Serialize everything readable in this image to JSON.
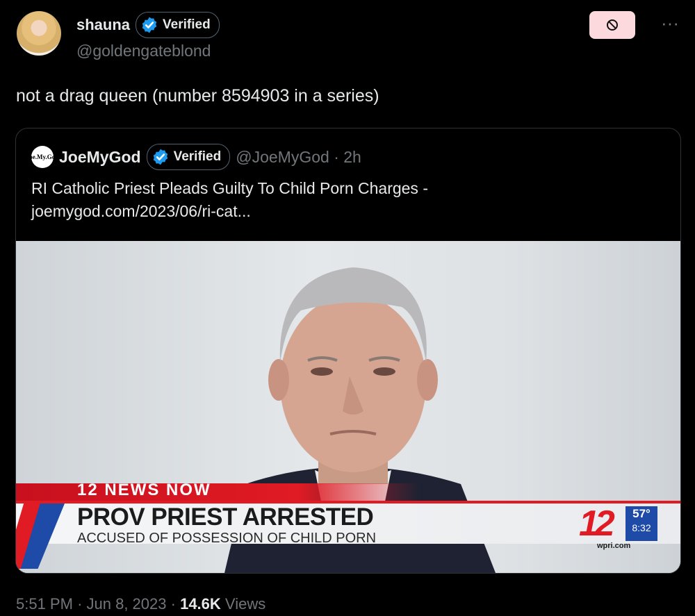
{
  "author": {
    "display_name": "shauna",
    "verified_label": "Verified",
    "handle": "@goldengateblond"
  },
  "tweet": {
    "text": "not a drag queen (number 8594903 in a series)"
  },
  "quoted": {
    "avatar_text": "Joe.My.God",
    "display_name": "JoeMyGod",
    "verified_label": "Verified",
    "handle_time": "@JoeMyGod · 2h",
    "text_line1": "RI Catholic Priest Pleads Guilty To Child Porn Charges -",
    "text_line2": "joemygod.com/2023/06/ri-cat...",
    "media": {
      "banner_tag": "12 NEWS NOW",
      "headline": "PROV PRIEST ARRESTED",
      "subhead": "ACCUSED OF POSSESSION OF CHILD PORN",
      "logo": "12",
      "temperature": "57°",
      "clock": "8:32",
      "site": "wpri.com"
    }
  },
  "footer": {
    "time": "5:51 PM",
    "date": "Jun 8, 2023",
    "views_count": "14.6K",
    "views_label": "Views",
    "sep": "·"
  },
  "colors": {
    "background": "#000000",
    "text": "#e7e9ea",
    "muted": "#71767b",
    "verified": "#1d9bf0",
    "block_button": "#fbd9dc",
    "news_red": "#e01b24",
    "news_blue": "#1e4aa8"
  }
}
